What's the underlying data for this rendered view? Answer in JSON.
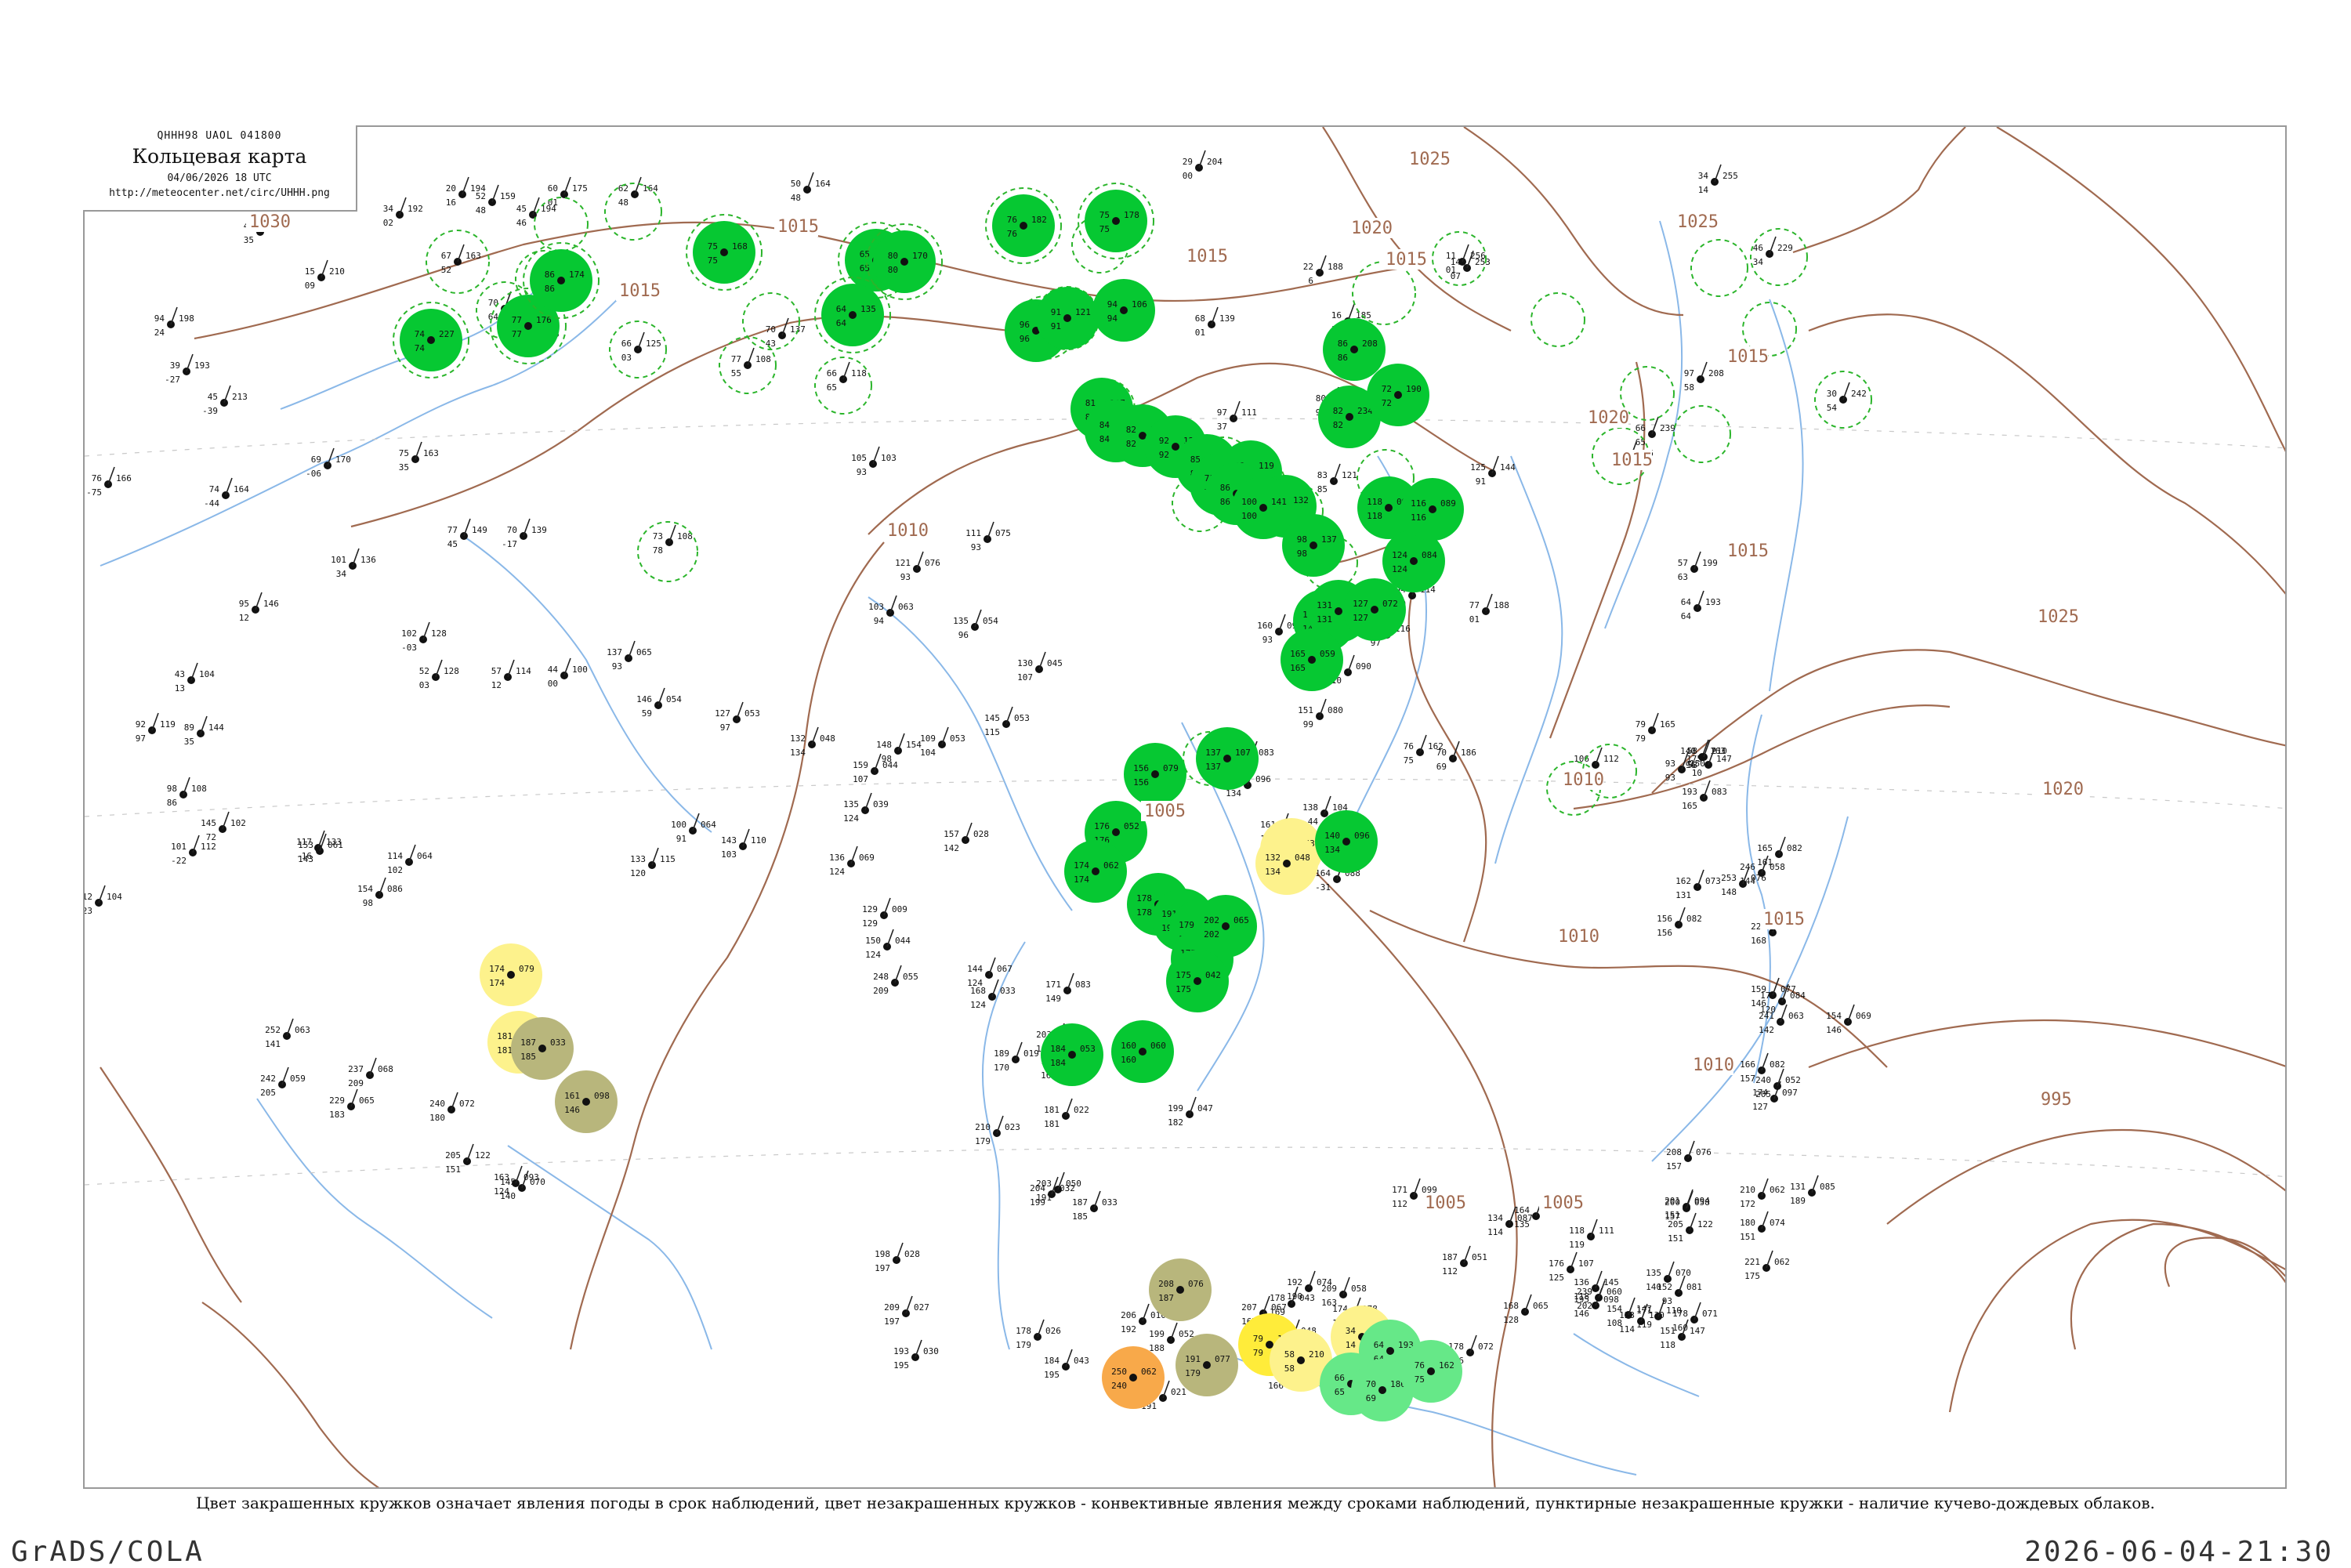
{
  "header": {
    "code": "QHHH98  UAOL  041800",
    "title": "Кольцевая карта",
    "date": "04/06/2026 18 UTC",
    "url": "http://meteocenter.net/circ/UHHH.png"
  },
  "caption": "Цвет закрашенных кружков означает явления погоды в срок наблюдений, цвет незакрашенных кружков - конвективные явления между сроками наблюдений, пунктирные незакрашенные кружки - наличие кучево-дождевых облаков.",
  "footer": {
    "left": "GrADS/COLA",
    "right": "2026-06-04-21:30"
  },
  "colors": {
    "rain": "#06c832",
    "shower": "#66e888",
    "fog": "#fdf28c",
    "haze": "#b8b67c",
    "dust": "#f8a94a",
    "yellow": "#ffec3a",
    "isobar": "#a06a50",
    "river": "#8ab8e8",
    "ring": "#2bb52b"
  },
  "isobar_labels": [
    {
      "text": "1030"
    },
    {
      "text": "1025"
    },
    {
      "text": "1020"
    },
    {
      "text": "1015"
    },
    {
      "text": "1015"
    },
    {
      "text": "1015"
    },
    {
      "text": "1015"
    },
    {
      "text": "1025"
    },
    {
      "text": "1020"
    },
    {
      "text": "1015"
    },
    {
      "text": "1010"
    },
    {
      "text": "1005"
    },
    {
      "text": "1010"
    },
    {
      "text": "1005"
    },
    {
      "text": "1010"
    },
    {
      "text": "1005"
    },
    {
      "text": "1020"
    },
    {
      "text": "1025"
    },
    {
      "text": "1015"
    },
    {
      "text": "1010"
    },
    {
      "text": "995"
    },
    {
      "text": "1015"
    },
    {
      "text": "1015"
    }
  ],
  "stations": [
    {
      "t": "20",
      "p": "194",
      "m": "16"
    },
    {
      "t": "52",
      "p": "159",
      "m": "48"
    },
    {
      "t": "60",
      "p": "175",
      "m": "01"
    },
    {
      "t": "62",
      "p": "164",
      "m": "48"
    },
    {
      "t": "45",
      "p": "194",
      "m": "46"
    },
    {
      "t": "66",
      "p": "125",
      "m": "03"
    },
    {
      "t": "70",
      "p": "155",
      "m": "64"
    },
    {
      "t": "67",
      "p": "163",
      "m": "52"
    },
    {
      "t": "55",
      "p": "145",
      "m": "42"
    },
    {
      "t": "50",
      "p": "164",
      "m": "48"
    },
    {
      "t": "92",
      "p": "158",
      "m": "93"
    },
    {
      "t": "29",
      "p": "204",
      "m": "00"
    },
    {
      "t": "46",
      "p": "207",
      "m": "35"
    },
    {
      "t": "34",
      "p": "192",
      "m": "02"
    },
    {
      "t": "15",
      "p": "210",
      "m": "09"
    },
    {
      "t": "94",
      "p": "198",
      "m": "24"
    },
    {
      "t": "39",
      "p": "193",
      "m": "-27"
    },
    {
      "t": "45",
      "p": "213",
      "m": "-39"
    },
    {
      "t": "76",
      "p": "166",
      "m": "-75"
    },
    {
      "t": "74",
      "p": "164",
      "m": "-44"
    },
    {
      "t": "69",
      "p": "170",
      "m": "-06"
    },
    {
      "t": "75",
      "p": "163",
      "m": "35"
    },
    {
      "t": "77",
      "p": "149",
      "m": "45"
    },
    {
      "t": "70",
      "p": "139",
      "m": "-17"
    },
    {
      "t": "101",
      "p": "136",
      "m": "34"
    },
    {
      "t": "95",
      "p": "146",
      "m": "12"
    },
    {
      "t": "73",
      "p": "108",
      "m": "78"
    },
    {
      "t": "70",
      "p": "137",
      "m": "43"
    },
    {
      "t": "77",
      "p": "108",
      "m": "55"
    },
    {
      "t": "66",
      "p": "118",
      "m": "65"
    },
    {
      "t": "105",
      "p": "103",
      "m": "93"
    },
    {
      "t": "111",
      "p": "075",
      "m": "93"
    },
    {
      "t": "121",
      "p": "076",
      "m": "93"
    },
    {
      "t": "103",
      "p": "063",
      "m": "94"
    },
    {
      "t": "135",
      "p": "054",
      "m": "96"
    },
    {
      "t": "130",
      "p": "045",
      "m": "107"
    },
    {
      "t": "68",
      "p": "139",
      "m": "01"
    },
    {
      "t": "97",
      "p": "111",
      "m": "37"
    },
    {
      "t": "80",
      "p": "137",
      "m": "96"
    },
    {
      "t": "83",
      "p": "121",
      "m": "85"
    },
    {
      "t": "22",
      "p": "188",
      "m": "6"
    },
    {
      "t": "16",
      "p": "185",
      "m": "13"
    },
    {
      "t": "11",
      "p": "256",
      "m": "01"
    },
    {
      "t": "14",
      "p": "253",
      "m": "07"
    },
    {
      "t": "46",
      "p": "229",
      "m": "34"
    },
    {
      "t": "34",
      "p": "255",
      "m": "14"
    },
    {
      "t": "97",
      "p": "208",
      "m": "58"
    },
    {
      "t": "30",
      "p": "242",
      "m": "54"
    },
    {
      "t": "125",
      "p": "144",
      "m": "91"
    },
    {
      "t": "70",
      "p": "206",
      "m": "69"
    },
    {
      "t": "66",
      "p": "239",
      "m": "65"
    },
    {
      "t": "57",
      "p": "199",
      "m": "63"
    },
    {
      "t": "64",
      "p": "193",
      "m": "64"
    },
    {
      "t": "94",
      "p": "114",
      "m": "80"
    },
    {
      "t": "77",
      "p": "188",
      "m": "01"
    },
    {
      "t": "160",
      "p": "099",
      "m": "93"
    },
    {
      "t": "117",
      "p": "116",
      "m": "97"
    },
    {
      "t": "110",
      "p": "070",
      "m": "97"
    },
    {
      "t": "136",
      "p": "090",
      "m": "110"
    },
    {
      "t": "151",
      "p": "080",
      "m": "99"
    },
    {
      "t": "76",
      "p": "162",
      "m": "75"
    },
    {
      "t": "70",
      "p": "186",
      "m": "69"
    },
    {
      "t": "93",
      "p": "150",
      "m": "93"
    },
    {
      "t": "140",
      "p": "163",
      "m": "96"
    },
    {
      "t": "79",
      "p": "165",
      "m": "79"
    },
    {
      "t": "58",
      "p": "210",
      "m": "58"
    },
    {
      "t": "175",
      "p": "147",
      "m": "10"
    },
    {
      "t": "106",
      "p": "112",
      "m": "-97"
    },
    {
      "t": "92",
      "p": "119",
      "m": "97"
    },
    {
      "t": "89",
      "p": "144",
      "m": "35"
    },
    {
      "t": "43",
      "p": "104",
      "m": "13"
    },
    {
      "t": "102",
      "p": "128",
      "m": "-03"
    },
    {
      "t": "52",
      "p": "128",
      "m": "03"
    },
    {
      "t": "57",
      "p": "114",
      "m": "12"
    },
    {
      "t": "44",
      "p": "100",
      "m": "00"
    },
    {
      "t": "137",
      "p": "065",
      "m": "93"
    },
    {
      "t": "146",
      "p": "054",
      "m": "59"
    },
    {
      "t": "127",
      "p": "053",
      "m": "97"
    },
    {
      "t": "132",
      "p": "048",
      "m": "134"
    },
    {
      "t": "109",
      "p": "053",
      "m": "104"
    },
    {
      "t": "159",
      "p": "044",
      "m": "107"
    },
    {
      "t": "148",
      "p": "154",
      "m": "98"
    },
    {
      "t": "145",
      "p": "053",
      "m": "115"
    },
    {
      "t": "167",
      "p": "083",
      "m": "103"
    },
    {
      "t": "140",
      "p": "096",
      "m": "134"
    },
    {
      "t": "161",
      "p": "134",
      "m": "140"
    },
    {
      "t": "138",
      "p": "104",
      "m": "-44"
    },
    {
      "t": "164",
      "p": "088",
      "m": "-31"
    },
    {
      "t": "101",
      "p": "112",
      "m": "-22"
    },
    {
      "t": "112",
      "p": "104",
      "m": "-23"
    },
    {
      "t": "98",
      "p": "108",
      "m": "86"
    },
    {
      "t": "145",
      "p": "102",
      "m": "72"
    },
    {
      "t": "117",
      "p": "133",
      "m": "-16"
    },
    {
      "t": "153",
      "p": "061",
      "m": "143"
    },
    {
      "t": "154",
      "p": "086",
      "m": "98"
    },
    {
      "t": "114",
      "p": "064",
      "m": "102"
    },
    {
      "t": "100",
      "p": "064",
      "m": "91"
    },
    {
      "t": "133",
      "p": "115",
      "m": "120"
    },
    {
      "t": "143",
      "p": "110",
      "m": "103"
    },
    {
      "t": "136",
      "p": "069",
      "m": "124"
    },
    {
      "t": "135",
      "p": "039",
      "m": "124"
    },
    {
      "t": "157",
      "p": "028",
      "m": "142"
    },
    {
      "t": "129",
      "p": "009",
      "m": "129"
    },
    {
      "t": "150",
      "p": "044",
      "m": "124"
    },
    {
      "t": "144",
      "p": "067",
      "m": "124"
    },
    {
      "t": "168",
      "p": "033",
      "m": "124"
    },
    {
      "t": "171",
      "p": "083",
      "m": "149"
    },
    {
      "t": "203",
      "p": "021",
      "m": "149"
    },
    {
      "t": "180",
      "p": "000",
      "m": "168"
    },
    {
      "t": "189",
      "p": "019",
      "m": "170"
    },
    {
      "t": "181",
      "p": "022",
      "m": "181"
    },
    {
      "t": "210",
      "p": "023",
      "m": "179"
    },
    {
      "t": "199",
      "p": "047",
      "m": "182"
    },
    {
      "t": "203",
      "p": "050",
      "m": "191"
    },
    {
      "t": "204",
      "p": "032",
      "m": "199"
    },
    {
      "t": "187",
      "p": "033",
      "m": "185"
    },
    {
      "t": "198",
      "p": "028",
      "m": "197"
    },
    {
      "t": "209",
      "p": "027",
      "m": "197"
    },
    {
      "t": "193",
      "p": "030",
      "m": "195"
    },
    {
      "t": "178",
      "p": "026",
      "m": "179"
    },
    {
      "t": "184",
      "p": "043",
      "m": "195"
    },
    {
      "t": "206",
      "p": "010",
      "m": "192"
    },
    {
      "t": "199",
      "p": "052",
      "m": "188"
    },
    {
      "t": "186",
      "p": "021",
      "m": "191"
    },
    {
      "t": "207",
      "p": "067",
      "m": "167"
    },
    {
      "t": "178",
      "p": "043",
      "m": "169"
    },
    {
      "t": "210",
      "p": "048",
      "m": "102"
    },
    {
      "t": "154",
      "p": "084",
      "m": "166"
    },
    {
      "t": "209",
      "p": "058",
      "m": "163"
    },
    {
      "t": "174",
      "p": "078",
      "m": "172"
    },
    {
      "t": "192",
      "p": "074",
      "m": "190"
    },
    {
      "t": "178",
      "p": "072",
      "m": "176"
    },
    {
      "t": "187",
      "p": "051",
      "m": "112"
    },
    {
      "t": "171",
      "p": "099",
      "m": "112"
    },
    {
      "t": "134",
      "p": "087",
      "m": "114"
    },
    {
      "t": "164",
      "p": "102",
      "m": "135"
    },
    {
      "t": "168",
      "p": "065",
      "m": "128"
    },
    {
      "t": "176",
      "p": "107",
      "m": "125"
    },
    {
      "t": "118",
      "p": "111",
      "m": "119"
    },
    {
      "t": "136",
      "p": "145",
      "m": "118"
    },
    {
      "t": "123",
      "p": "130",
      "m": "114"
    },
    {
      "t": "154",
      "p": "147",
      "m": "108"
    },
    {
      "t": "171",
      "p": "110",
      "m": "119"
    },
    {
      "t": "151",
      "p": "147",
      "m": "118"
    },
    {
      "t": "178",
      "p": "071",
      "m": "160"
    },
    {
      "t": "152",
      "p": "081",
      "m": "93"
    },
    {
      "t": "205",
      "p": "122",
      "m": "151"
    },
    {
      "t": "135",
      "p": "070",
      "m": "140"
    },
    {
      "t": "201",
      "p": "094",
      "m": "151"
    },
    {
      "t": "208",
      "p": "076",
      "m": "157"
    },
    {
      "t": "180",
      "p": "074",
      "m": "151"
    },
    {
      "t": "221",
      "p": "062",
      "m": "175"
    },
    {
      "t": "210",
      "p": "062",
      "m": "172"
    },
    {
      "t": "131",
      "p": "085",
      "m": "189"
    },
    {
      "t": "174",
      "p": "097",
      "m": "127"
    },
    {
      "t": "195",
      "p": "098",
      "m": "146"
    },
    {
      "t": "166",
      "p": "082",
      "m": "157"
    },
    {
      "t": "177",
      "p": "084",
      "m": "120"
    },
    {
      "t": "159",
      "p": "077",
      "m": "146"
    },
    {
      "t": "154",
      "p": "069",
      "m": "146"
    },
    {
      "t": "156",
      "p": "082",
      "m": "156"
    },
    {
      "t": "162",
      "p": "073",
      "m": "131"
    },
    {
      "t": "193",
      "p": "083",
      "m": "165"
    },
    {
      "t": "165",
      "p": "082",
      "m": "161"
    },
    {
      "t": "246",
      "p": "058",
      "m": "144"
    },
    {
      "t": "253",
      "p": "076",
      "m": "148"
    },
    {
      "t": "226",
      "p": "054",
      "m": "168"
    },
    {
      "t": "241",
      "p": "063",
      "m": "142"
    },
    {
      "t": "240",
      "p": "052",
      "m": "205"
    },
    {
      "t": "239",
      "p": "060",
      "m": "202"
    },
    {
      "t": "200",
      "p": "058",
      "m": "157"
    },
    {
      "t": "252",
      "p": "063",
      "m": "141"
    },
    {
      "t": "242",
      "p": "059",
      "m": "205"
    },
    {
      "t": "229",
      "p": "065",
      "m": "183"
    },
    {
      "t": "237",
      "p": "068",
      "m": "209"
    },
    {
      "t": "248",
      "p": "055",
      "m": "209"
    },
    {
      "t": "240",
      "p": "072",
      "m": "180"
    },
    {
      "t": "205",
      "p": "122",
      "m": "151"
    },
    {
      "t": "145",
      "p": "070",
      "m": "140"
    },
    {
      "t": "163",
      "p": "093",
      "m": "124"
    }
  ],
  "circles": [
    {
      "t": "74",
      "p": "227",
      "m": "74"
    },
    {
      "t": "77",
      "p": "176",
      "m": "77"
    },
    {
      "t": "86",
      "p": "174",
      "m": "86"
    },
    {
      "t": "65",
      "p": "152",
      "m": "65"
    },
    {
      "t": "80",
      "p": "170",
      "m": "80"
    },
    {
      "t": "75",
      "p": "168",
      "m": "75"
    },
    {
      "t": "64",
      "p": "135",
      "m": "64"
    },
    {
      "t": "76",
      "p": "182",
      "m": "76"
    },
    {
      "t": "75",
      "p": "178",
      "m": "75"
    },
    {
      "t": "96",
      "p": "125",
      "m": "96"
    },
    {
      "t": "91",
      "p": "121",
      "m": "91"
    },
    {
      "t": "94",
      "p": "106",
      "m": "94"
    },
    {
      "t": "81",
      "p": "107",
      "m": "81"
    },
    {
      "t": "84",
      "p": "093",
      "m": "84"
    },
    {
      "t": "82",
      "p": "108",
      "m": "82"
    },
    {
      "t": "92",
      "p": "120",
      "m": "92"
    },
    {
      "t": "85",
      "p": "110",
      "m": "85"
    },
    {
      "t": "71",
      "p": "118",
      "m": "71"
    },
    {
      "t": "68",
      "p": "119",
      "m": "68"
    },
    {
      "t": "86",
      "p": "133",
      "m": "86"
    },
    {
      "t": "64",
      "p": "132",
      "m": "64"
    },
    {
      "t": "82",
      "p": "234",
      "m": "82"
    },
    {
      "t": "86",
      "p": "208",
      "m": "86"
    },
    {
      "t": "72",
      "p": "190",
      "m": "72"
    },
    {
      "t": "100",
      "p": "141",
      "m": "100"
    },
    {
      "t": "98",
      "p": "137",
      "m": "98"
    },
    {
      "t": "118",
      "p": "097",
      "m": "118"
    },
    {
      "t": "124",
      "p": "084",
      "m": "124"
    },
    {
      "t": "116",
      "p": "089",
      "m": "116"
    },
    {
      "t": "140",
      "p": "060",
      "m": "140"
    },
    {
      "t": "131",
      "p": "075",
      "m": "131"
    },
    {
      "t": "127",
      "p": "072",
      "m": "127"
    },
    {
      "t": "165",
      "p": "059",
      "m": "165"
    },
    {
      "t": "137",
      "p": "107",
      "m": "137"
    },
    {
      "t": "156",
      "p": "079",
      "m": "156"
    },
    {
      "t": "176",
      "p": "052",
      "m": "176"
    },
    {
      "t": "174",
      "p": "062",
      "m": "174"
    },
    {
      "t": "178",
      "p": "045",
      "m": "178"
    },
    {
      "t": "191",
      "p": "060",
      "m": "191"
    },
    {
      "t": "179",
      "p": "059",
      "m": "179"
    },
    {
      "t": "175",
      "p": "064",
      "m": "175"
    },
    {
      "t": "184",
      "p": "053",
      "m": "184"
    },
    {
      "t": "160",
      "p": "060",
      "m": "160"
    },
    {
      "t": "202",
      "p": "065",
      "m": "202"
    },
    {
      "t": "175",
      "p": "042",
      "m": "175"
    },
    {
      "t": "196",
      "p": "063",
      "m": "196"
    },
    {
      "t": "132",
      "p": "048",
      "m": "134"
    },
    {
      "t": "140",
      "p": "096",
      "m": "134"
    },
    {
      "t": "174",
      "p": "079",
      "m": "174"
    },
    {
      "t": "181",
      "p": "022",
      "m": "181"
    },
    {
      "t": "187",
      "p": "033",
      "m": "185"
    },
    {
      "t": "161",
      "p": "098",
      "m": "146"
    },
    {
      "t": "208",
      "p": "076",
      "m": "187"
    },
    {
      "t": "191",
      "p": "077",
      "m": "179"
    },
    {
      "t": "250",
      "p": "062",
      "m": "240"
    },
    {
      "t": "79",
      "p": "165",
      "m": "79"
    },
    {
      "t": "58",
      "p": "210",
      "m": "58"
    },
    {
      "t": "34",
      "p": "255",
      "m": "14"
    },
    {
      "t": "64",
      "p": "193",
      "m": "64"
    },
    {
      "t": "66",
      "p": "239",
      "m": "65"
    },
    {
      "t": "70",
      "p": "186",
      "m": "69"
    },
    {
      "t": "76",
      "p": "162",
      "m": "75"
    }
  ]
}
